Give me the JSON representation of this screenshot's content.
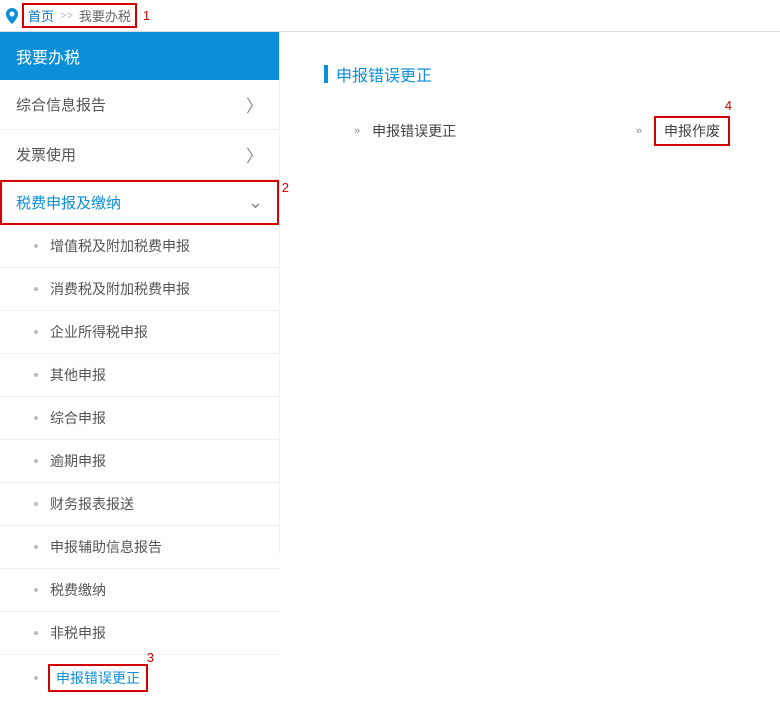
{
  "breadcrumb": {
    "home": "首页",
    "current": "我要办税"
  },
  "annotations": {
    "n1": "1",
    "n2": "2",
    "n3": "3",
    "n4": "4"
  },
  "sidebar": {
    "header": "我要办税",
    "items": [
      {
        "label": "综合信息报告"
      },
      {
        "label": "发票使用"
      },
      {
        "label": "税费申报及缴纳"
      }
    ],
    "submenu": [
      "增值税及附加税费申报",
      "消费税及附加税费申报",
      "企业所得税申报",
      "其他申报",
      "综合申报",
      "逾期申报",
      "财务报表报送",
      "申报辅助信息报告",
      "税费缴纳",
      "非税申报",
      "申报错误更正"
    ]
  },
  "content": {
    "title": "申报错误更正",
    "link1": "申报错误更正",
    "link2": "申报作废"
  }
}
